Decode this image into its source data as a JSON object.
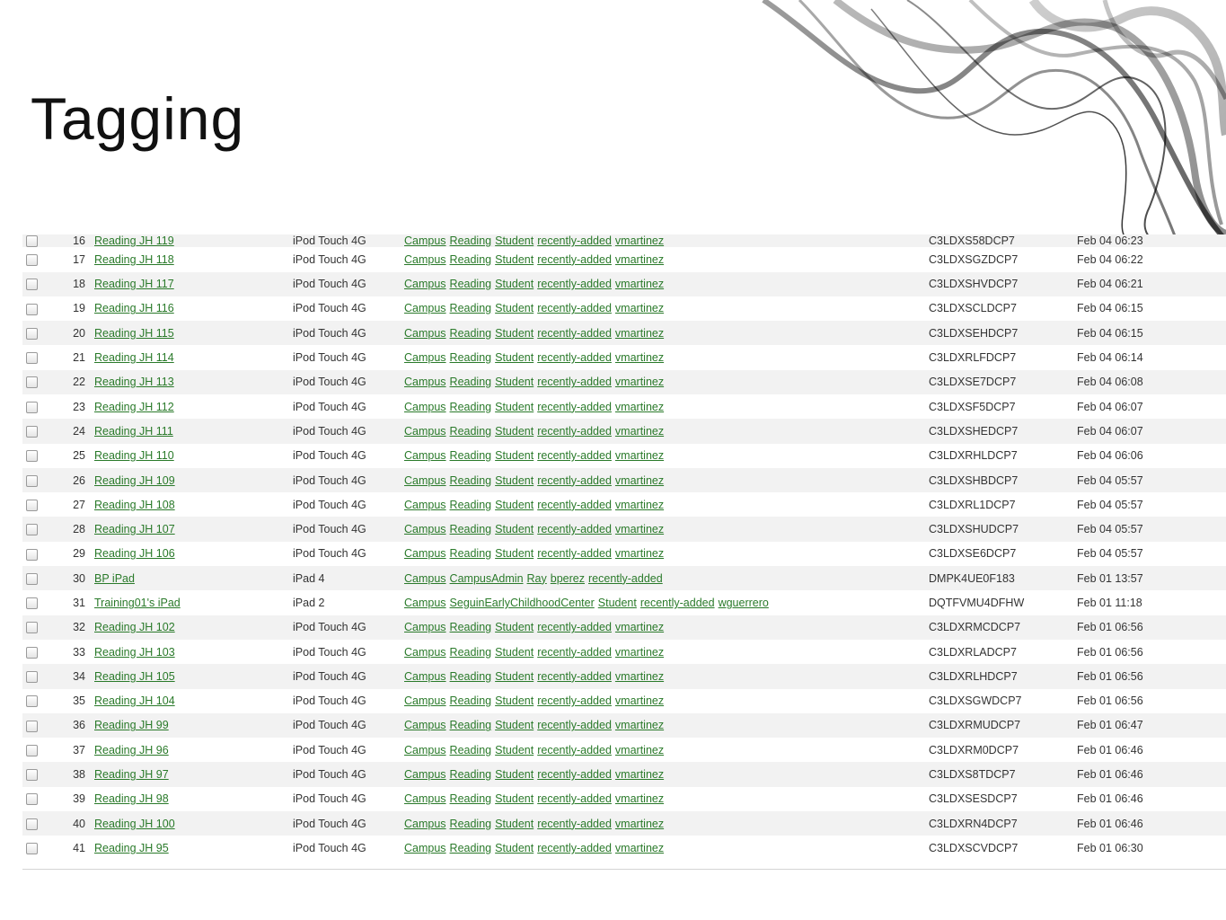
{
  "slide": {
    "title": "Tagging"
  },
  "colors": {
    "link": "#2a7a2a",
    "text": "#333333",
    "row_alt": "#f2f2f2"
  },
  "table": {
    "partial_row": {
      "num": "16",
      "name": "Reading JH 119",
      "model": "iPod Touch 4G",
      "tags": [
        "Campus",
        "Reading",
        "Student",
        "recently-added",
        "vmartinez"
      ],
      "serial": "C3LDXS58DCP7",
      "date": "Feb 04 06:23"
    },
    "rows": [
      {
        "num": "17",
        "name": "Reading JH 118",
        "model": "iPod Touch 4G",
        "tags": [
          "Campus",
          "Reading",
          "Student",
          "recently-added",
          "vmartinez"
        ],
        "serial": "C3LDXSGZDCP7",
        "date": "Feb 04 06:22"
      },
      {
        "num": "18",
        "name": "Reading JH 117",
        "model": "iPod Touch 4G",
        "tags": [
          "Campus",
          "Reading",
          "Student",
          "recently-added",
          "vmartinez"
        ],
        "serial": "C3LDXSHVDCP7",
        "date": "Feb 04 06:21"
      },
      {
        "num": "19",
        "name": "Reading JH 116",
        "model": "iPod Touch 4G",
        "tags": [
          "Campus",
          "Reading",
          "Student",
          "recently-added",
          "vmartinez"
        ],
        "serial": "C3LDXSCLDCP7",
        "date": "Feb 04 06:15"
      },
      {
        "num": "20",
        "name": "Reading JH 115",
        "model": "iPod Touch 4G",
        "tags": [
          "Campus",
          "Reading",
          "Student",
          "recently-added",
          "vmartinez"
        ],
        "serial": "C3LDXSEHDCP7",
        "date": "Feb 04 06:15"
      },
      {
        "num": "21",
        "name": "Reading JH 114",
        "model": "iPod Touch 4G",
        "tags": [
          "Campus",
          "Reading",
          "Student",
          "recently-added",
          "vmartinez"
        ],
        "serial": "C3LDXRLFDCP7",
        "date": "Feb 04 06:14"
      },
      {
        "num": "22",
        "name": "Reading JH 113",
        "model": "iPod Touch 4G",
        "tags": [
          "Campus",
          "Reading",
          "Student",
          "recently-added",
          "vmartinez"
        ],
        "serial": "C3LDXSE7DCP7",
        "date": "Feb 04 06:08"
      },
      {
        "num": "23",
        "name": "Reading JH 112",
        "model": "iPod Touch 4G",
        "tags": [
          "Campus",
          "Reading",
          "Student",
          "recently-added",
          "vmartinez"
        ],
        "serial": "C3LDXSF5DCP7",
        "date": "Feb 04 06:07"
      },
      {
        "num": "24",
        "name": "Reading JH 111",
        "model": "iPod Touch 4G",
        "tags": [
          "Campus",
          "Reading",
          "Student",
          "recently-added",
          "vmartinez"
        ],
        "serial": "C3LDXSHEDCP7",
        "date": "Feb 04 06:07"
      },
      {
        "num": "25",
        "name": "Reading JH 110",
        "model": "iPod Touch 4G",
        "tags": [
          "Campus",
          "Reading",
          "Student",
          "recently-added",
          "vmartinez"
        ],
        "serial": "C3LDXRHLDCP7",
        "date": "Feb 04 06:06"
      },
      {
        "num": "26",
        "name": "Reading JH 109",
        "model": "iPod Touch 4G",
        "tags": [
          "Campus",
          "Reading",
          "Student",
          "recently-added",
          "vmartinez"
        ],
        "serial": "C3LDXSHBDCP7",
        "date": "Feb 04 05:57"
      },
      {
        "num": "27",
        "name": "Reading JH 108",
        "model": "iPod Touch 4G",
        "tags": [
          "Campus",
          "Reading",
          "Student",
          "recently-added",
          "vmartinez"
        ],
        "serial": "C3LDXRL1DCP7",
        "date": "Feb 04 05:57"
      },
      {
        "num": "28",
        "name": "Reading JH 107",
        "model": "iPod Touch 4G",
        "tags": [
          "Campus",
          "Reading",
          "Student",
          "recently-added",
          "vmartinez"
        ],
        "serial": "C3LDXSHUDCP7",
        "date": "Feb 04 05:57"
      },
      {
        "num": "29",
        "name": "Reading JH 106",
        "model": "iPod Touch 4G",
        "tags": [
          "Campus",
          "Reading",
          "Student",
          "recently-added",
          "vmartinez"
        ],
        "serial": "C3LDXSE6DCP7",
        "date": "Feb 04 05:57"
      },
      {
        "num": "30",
        "name": "BP iPad",
        "model": "iPad 4",
        "tags": [
          "Campus",
          "CampusAdmin",
          "Ray",
          "bperez",
          "recently-added"
        ],
        "serial": "DMPK4UE0F183",
        "date": "Feb 01 13:57"
      },
      {
        "num": "31",
        "name": "Training01's iPad",
        "model": "iPad 2",
        "tags": [
          "Campus",
          "SeguinEarlyChildhoodCenter",
          "Student",
          "recently-added",
          "wguerrero"
        ],
        "serial": "DQTFVMU4DFHW",
        "date": "Feb 01 11:18"
      },
      {
        "num": "32",
        "name": "Reading JH 102",
        "model": "iPod Touch 4G",
        "tags": [
          "Campus",
          "Reading",
          "Student",
          "recently-added",
          "vmartinez"
        ],
        "serial": "C3LDXRMCDCP7",
        "date": "Feb 01 06:56"
      },
      {
        "num": "33",
        "name": "Reading JH 103",
        "model": "iPod Touch 4G",
        "tags": [
          "Campus",
          "Reading",
          "Student",
          "recently-added",
          "vmartinez"
        ],
        "serial": "C3LDXRLADCP7",
        "date": "Feb 01 06:56"
      },
      {
        "num": "34",
        "name": "Reading JH 105",
        "model": "iPod Touch 4G",
        "tags": [
          "Campus",
          "Reading",
          "Student",
          "recently-added",
          "vmartinez"
        ],
        "serial": "C3LDXRLHDCP7",
        "date": "Feb 01 06:56"
      },
      {
        "num": "35",
        "name": "Reading JH 104",
        "model": "iPod Touch 4G",
        "tags": [
          "Campus",
          "Reading",
          "Student",
          "recently-added",
          "vmartinez"
        ],
        "serial": "C3LDXSGWDCP7",
        "date": "Feb 01 06:56"
      },
      {
        "num": "36",
        "name": "Reading JH 99",
        "model": "iPod Touch 4G",
        "tags": [
          "Campus",
          "Reading",
          "Student",
          "recently-added",
          "vmartinez"
        ],
        "serial": "C3LDXRMUDCP7",
        "date": "Feb 01 06:47"
      },
      {
        "num": "37",
        "name": "Reading JH 96",
        "model": "iPod Touch 4G",
        "tags": [
          "Campus",
          "Reading",
          "Student",
          "recently-added",
          "vmartinez"
        ],
        "serial": "C3LDXRM0DCP7",
        "date": "Feb 01 06:46"
      },
      {
        "num": "38",
        "name": "Reading JH 97",
        "model": "iPod Touch 4G",
        "tags": [
          "Campus",
          "Reading",
          "Student",
          "recently-added",
          "vmartinez"
        ],
        "serial": "C3LDXS8TDCP7",
        "date": "Feb 01 06:46"
      },
      {
        "num": "39",
        "name": "Reading JH 98",
        "model": "iPod Touch 4G",
        "tags": [
          "Campus",
          "Reading",
          "Student",
          "recently-added",
          "vmartinez"
        ],
        "serial": "C3LDXSESDCP7",
        "date": "Feb 01 06:46"
      },
      {
        "num": "40",
        "name": "Reading JH 100",
        "model": "iPod Touch 4G",
        "tags": [
          "Campus",
          "Reading",
          "Student",
          "recently-added",
          "vmartinez"
        ],
        "serial": "C3LDXRN4DCP7",
        "date": "Feb 01 06:46"
      },
      {
        "num": "41",
        "name": "Reading JH 95",
        "model": "iPod Touch 4G",
        "tags": [
          "Campus",
          "Reading",
          "Student",
          "recently-added",
          "vmartinez"
        ],
        "serial": "C3LDXSCVDCP7",
        "date": "Feb 01 06:30"
      }
    ]
  }
}
